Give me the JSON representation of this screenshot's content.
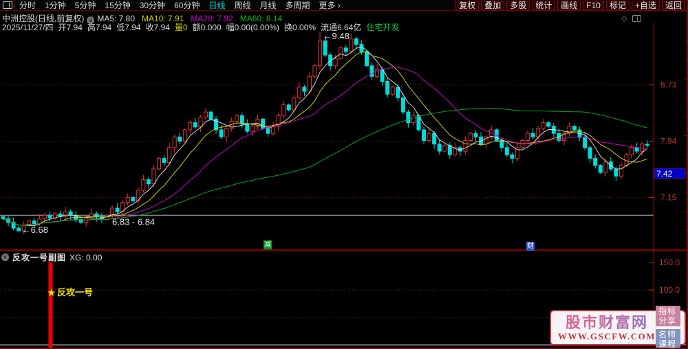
{
  "toolbar": {
    "periods": [
      "分时",
      "1分钟",
      "5分钟",
      "15分钟",
      "30分钟",
      "60分钟",
      "日线",
      "周线",
      "月线",
      "多周期",
      "更多 ›"
    ],
    "active_period": "日线",
    "actions": [
      "复权",
      "叠加",
      "多股",
      "统计",
      "画线",
      "F10",
      "标记",
      "+自选",
      "返回"
    ]
  },
  "info": {
    "title": "中洲控股(日线,前复权)",
    "ma_labels": [
      {
        "label": "MA5: 7.80",
        "color": "#d8d8d8"
      },
      {
        "label": "MA10: 7.91",
        "color": "#cfcf00"
      },
      {
        "label": "MA20: 7.92",
        "color": "#cc00cc"
      },
      {
        "label": "MA60: 8.14",
        "color": "#00b820"
      }
    ],
    "date": "2025/11/27/四",
    "fields": [
      {
        "text": "开7.94",
        "color": "#d8d8d8"
      },
      {
        "text": "高7.94",
        "color": "#d8d8d8"
      },
      {
        "text": "低7.94",
        "color": "#d8d8d8"
      },
      {
        "text": "收7.94",
        "color": "#d8d8d8"
      },
      {
        "text": "量0",
        "color": "#cfcf00"
      },
      {
        "text": "额0.000",
        "color": "#d8d8d8"
      },
      {
        "text": "幅0.00(0.00%)",
        "color": "#d8d8d8"
      },
      {
        "text": "换0.00%",
        "color": "#d8d8d8"
      },
      {
        "text": "流通6.64亿",
        "color": "#d8d8d8"
      },
      {
        "text": "住宅开发",
        "color": "#00cc44"
      }
    ]
  },
  "chart_data": [
    {
      "type": "candlestick",
      "title": "中洲控股 日线 前复权",
      "ylim": [
        6.43,
        9.47
      ],
      "y_axis_ticks": [
        8.73,
        7.94,
        7.15
      ],
      "first_open": 6.88,
      "closes": [
        6.85,
        6.8,
        6.72,
        6.68,
        6.76,
        6.82,
        6.78,
        6.85,
        6.9,
        6.86,
        6.92,
        6.88,
        6.95,
        6.9,
        6.84,
        6.8,
        6.86,
        6.92,
        6.88,
        6.84,
        6.9,
        7.0,
        6.95,
        7.08,
        7.15,
        7.1,
        7.25,
        7.4,
        7.34,
        7.55,
        7.7,
        7.64,
        7.85,
        8.0,
        7.94,
        8.1,
        8.2,
        8.14,
        8.28,
        8.35,
        8.25,
        8.1,
        8.0,
        8.12,
        8.22,
        8.3,
        8.18,
        8.08,
        8.15,
        8.25,
        8.12,
        8.05,
        8.15,
        8.3,
        8.45,
        8.38,
        8.55,
        8.7,
        8.64,
        8.85,
        9.0,
        9.35,
        9.15,
        9.0,
        9.1,
        9.25,
        9.2,
        9.38,
        9.3,
        9.2,
        9.0,
        8.85,
        8.95,
        8.78,
        8.6,
        8.7,
        8.55,
        8.35,
        8.2,
        8.3,
        8.1,
        7.95,
        8.05,
        7.9,
        7.8,
        7.88,
        7.75,
        7.85,
        7.8,
        7.95,
        8.05,
        8.0,
        7.9,
        8.0,
        8.1,
        7.95,
        7.85,
        7.75,
        7.7,
        7.85,
        7.95,
        8.05,
        8.0,
        8.12,
        8.2,
        8.15,
        8.05,
        7.95,
        8.05,
        8.15,
        8.1,
        8.0,
        7.85,
        7.7,
        7.6,
        7.5,
        7.65,
        7.55,
        7.45,
        7.6,
        7.75,
        7.85,
        7.8,
        7.9,
        7.88
      ],
      "ma_periods": [
        5,
        10,
        20,
        60
      ],
      "ma_colors": [
        "#d8d8d8",
        "#cfcf00",
        "#c800c8",
        "#00a820"
      ],
      "high_annotation": {
        "index": 61,
        "value": 9.48,
        "label": "←9.48"
      },
      "low_annotation": {
        "index": 3,
        "value": 6.68,
        "label": "←6.68"
      },
      "hline": {
        "price": 6.9,
        "label": "6.83 - 6.84"
      },
      "last_price_marker": "7.42",
      "event_badges": [
        {
          "text": "减",
          "color": "#009922",
          "x": 383
        },
        {
          "text": "财",
          "color": "#2952cc",
          "x": 765
        }
      ]
    },
    {
      "type": "bar",
      "title": "反攻一号副图",
      "ylim": [
        0,
        175
      ],
      "y_tick_labels": [
        "150.0",
        "100.0"
      ],
      "y_tick_values": [
        150,
        100
      ],
      "dotted_levels": [
        100,
        50
      ],
      "bars": [
        {
          "index": 9,
          "value": 150
        }
      ],
      "signal": {
        "index": 9,
        "level": 100,
        "star": "★",
        "label": "反攻一号"
      }
    }
  ],
  "sub_chart": {
    "title": "反攻一号副图",
    "value_label": "XG: 0.00"
  },
  "watermark": {
    "title": "股市财富网",
    "url": "WWW.GSCFW.COM",
    "badges": [
      "指标分享",
      "名师课程"
    ]
  }
}
